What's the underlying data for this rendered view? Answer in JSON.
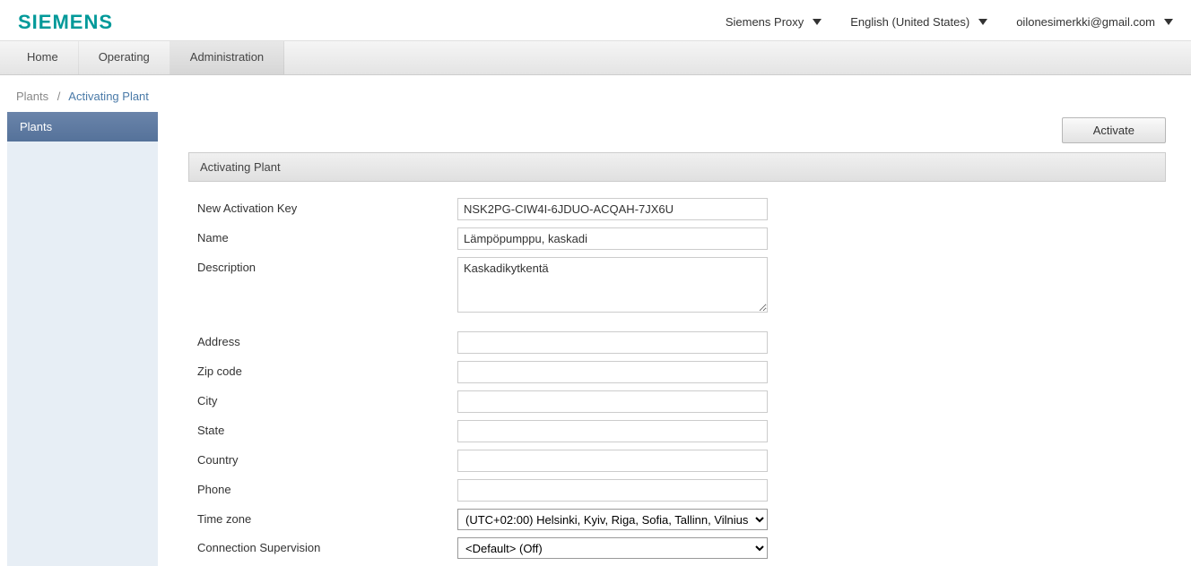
{
  "header": {
    "logo": "SIEMENS",
    "proxy": "Siemens Proxy",
    "language": "English (United States)",
    "user": "oilonesimerkki@gmail.com"
  },
  "nav": {
    "home": "Home",
    "operating": "Operating",
    "administration": "Administration"
  },
  "breadcrumb": {
    "root": "Plants",
    "current": "Activating Plant"
  },
  "sidebar": {
    "plants": "Plants"
  },
  "actions": {
    "activate": "Activate"
  },
  "panel": {
    "title": "Activating Plant"
  },
  "form": {
    "activation_key": {
      "label": "New Activation Key",
      "value": "NSK2PG-CIW4I-6JDUO-ACQAH-7JX6U"
    },
    "name": {
      "label": "Name",
      "value": "Lämpöpumppu, kaskadi"
    },
    "description": {
      "label": "Description",
      "value": "Kaskadikytkentä"
    },
    "address": {
      "label": "Address",
      "value": ""
    },
    "zip": {
      "label": "Zip code",
      "value": ""
    },
    "city": {
      "label": "City",
      "value": ""
    },
    "state": {
      "label": "State",
      "value": ""
    },
    "country": {
      "label": "Country",
      "value": ""
    },
    "phone": {
      "label": "Phone",
      "value": ""
    },
    "timezone": {
      "label": "Time zone",
      "value": "(UTC+02:00) Helsinki, Kyiv, Riga, Sofia, Tallinn, Vilnius"
    },
    "supervision": {
      "label": "Connection Supervision",
      "value": "<Default> (Off)"
    }
  }
}
